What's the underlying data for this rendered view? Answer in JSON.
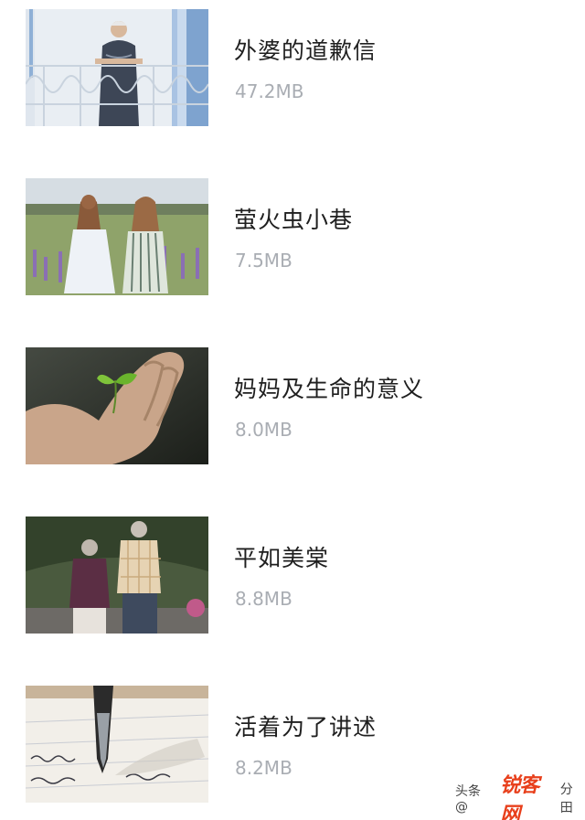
{
  "items": [
    {
      "title": "外婆的道歉信",
      "size": "47.2MB",
      "thumb_icon": "grandmother-balcony-photo"
    },
    {
      "title": "萤火虫小巷",
      "size": "7.5MB",
      "thumb_icon": "two-girls-field-photo"
    },
    {
      "title": "妈妈及生命的意义",
      "size": "8.0MB",
      "thumb_icon": "hand-sprout-photo"
    },
    {
      "title": "平如美棠",
      "size": "8.8MB",
      "thumb_icon": "elderly-couple-walking-photo"
    },
    {
      "title": "活着为了讲述",
      "size": "8.2MB",
      "thumb_icon": "fountain-pen-writing-photo"
    }
  ],
  "watermark": {
    "prefix": "头条 @",
    "brand": "锐客网",
    "suffix": "分田"
  }
}
